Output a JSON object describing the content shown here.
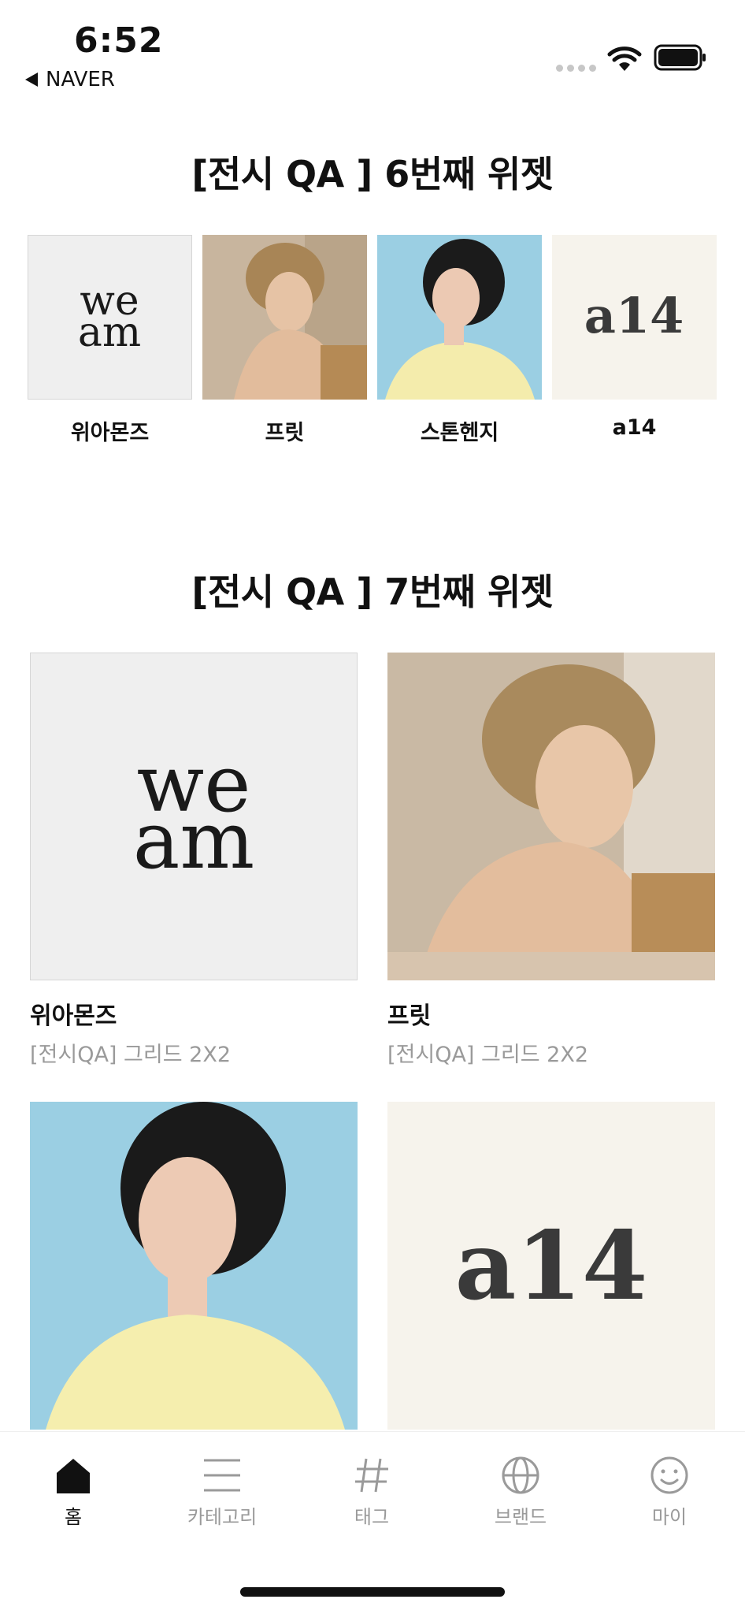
{
  "status_bar": {
    "time": "6:52",
    "back_app": "NAVER"
  },
  "widget6": {
    "title": "[전시 QA ] 6번째 위젯",
    "items": [
      {
        "label": "위아몬즈",
        "image": "weam-logo",
        "bg": "#efefef"
      },
      {
        "label": "프릿",
        "image": "model-blonde-photo",
        "bg": "#c9b39a"
      },
      {
        "label": "스톤헨지",
        "image": "model-bob-photo",
        "bg": "#9bcfe3"
      },
      {
        "label": "a14",
        "image": "a14-logo",
        "bg": "#f6f3ec"
      }
    ]
  },
  "widget7": {
    "title": "[전시 QA ] 7번째 위젯",
    "items": [
      {
        "name": "위아몬즈",
        "subtitle": "[전시QA] 그리드 2X2",
        "image": "weam-logo"
      },
      {
        "name": "프릿",
        "subtitle": "[전시QA] 그리드 2X2",
        "image": "model-blonde-photo"
      },
      {
        "name": "",
        "subtitle": "",
        "image": "model-bob-photo"
      },
      {
        "name": "",
        "subtitle": "",
        "image": "a14-logo"
      }
    ]
  },
  "logos": {
    "weam_line1": "we",
    "weam_line2": "am",
    "a14": "a14"
  },
  "tab_bar": {
    "tabs": [
      {
        "label": "홈",
        "icon": "home-icon",
        "active": true
      },
      {
        "label": "카테고리",
        "icon": "menu-icon",
        "active": false
      },
      {
        "label": "태그",
        "icon": "hashtag-icon",
        "active": false
      },
      {
        "label": "브랜드",
        "icon": "globe-icon",
        "active": false
      },
      {
        "label": "마이",
        "icon": "smiley-icon",
        "active": false
      }
    ]
  },
  "colors": {
    "text": "#111111",
    "muted": "#9a9a9a",
    "sky": "#9bcfe3",
    "cream": "#f6f3ec"
  }
}
